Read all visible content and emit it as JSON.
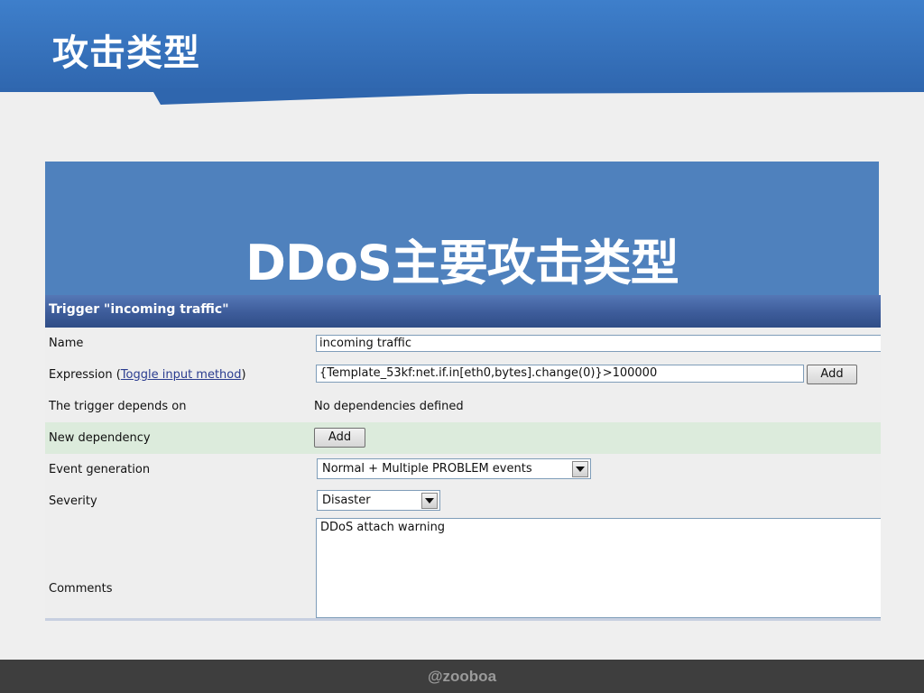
{
  "slide": {
    "title": "攻击类型",
    "banner_title": "DDoS主要攻击类型",
    "footer": "@zooboa",
    "colors": {
      "header": "#3e7fcb",
      "banner": "#4f81bd",
      "footer": "#3e3e3e",
      "form_header": "#3d5c9a",
      "row_highlight": "#dcebdc"
    }
  },
  "form": {
    "title": "Trigger \"incoming traffic\"",
    "name": {
      "label": "Name",
      "value": "incoming traffic"
    },
    "expression": {
      "label": "Expression",
      "paren_open": "(",
      "toggle_link": "Toggle input method",
      "paren_close": ")",
      "value": "{Template_53kf:net.if.in[eth0,bytes].change(0)}>100000",
      "add_button": "Add"
    },
    "depends_on": {
      "label": "The trigger depends on",
      "value": "No dependencies defined"
    },
    "new_dependency": {
      "label": "New dependency",
      "add_button": "Add"
    },
    "event_generation": {
      "label": "Event generation",
      "selected": "Normal + Multiple PROBLEM events"
    },
    "severity": {
      "label": "Severity",
      "selected": "Disaster"
    },
    "comments": {
      "label": "Comments",
      "value": "DDoS attach warning"
    }
  }
}
